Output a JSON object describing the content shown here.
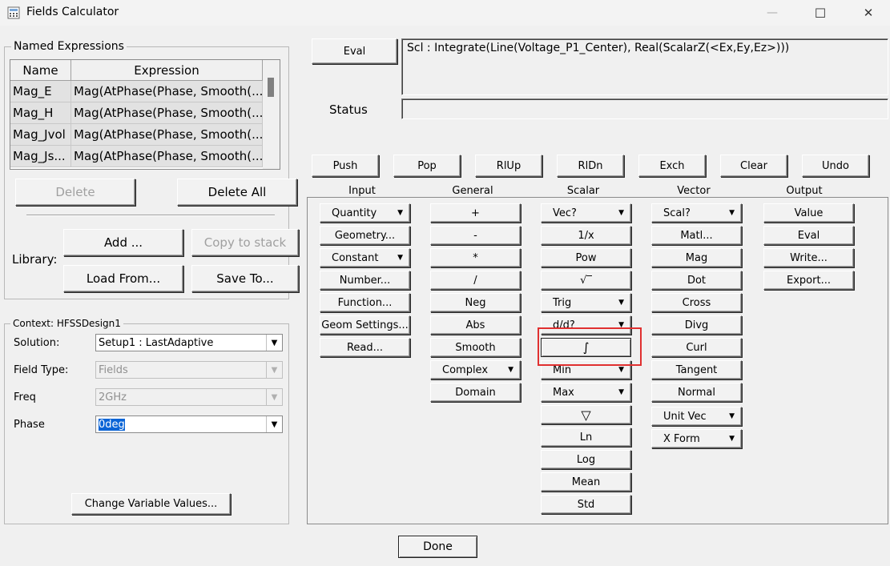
{
  "window": {
    "title": "Fields Calculator",
    "minimize": "—",
    "maximize": "☐",
    "close": "✕"
  },
  "named_expressions": {
    "group_label": "Named Expressions",
    "columns": [
      "Name",
      "Expression"
    ],
    "rows": [
      {
        "name": "Mag_E",
        "expression": "Mag(AtPhase(Phase, Smooth(..."
      },
      {
        "name": "Mag_H",
        "expression": "Mag(AtPhase(Phase, Smooth(..."
      },
      {
        "name": "Mag_Jvol",
        "expression": "Mag(AtPhase(Phase, Smooth(..."
      },
      {
        "name": "Mag_Js...",
        "expression": "Mag(AtPhase(Phase, Smooth(..."
      }
    ],
    "delete_label": "Delete",
    "delete_all_label": "Delete All",
    "library_label": "Library:",
    "add_label": "Add ...",
    "copy_to_stack_label": "Copy to stack",
    "load_from_label": "Load From...",
    "save_to_label": "Save To..."
  },
  "context": {
    "group_label": "Context: HFSSDesign1",
    "solution_label": "Solution:",
    "solution_value": "Setup1 : LastAdaptive",
    "field_type_label": "Field Type:",
    "field_type_value": "Fields",
    "freq_label": "Freq",
    "freq_value": "2GHz",
    "phase_label": "Phase",
    "phase_value": "0deg",
    "change_vars_label": "Change Variable Values..."
  },
  "top": {
    "eval_label": "Eval",
    "expression": "Scl : Integrate(Line(Voltage_P1_Center), Real(ScalarZ(<Ex,Ey,Ez>)))",
    "status_label": "Status",
    "status_value": ""
  },
  "stack_buttons": [
    "Push",
    "Pop",
    "RlUp",
    "RlDn",
    "Exch",
    "Clear",
    "Undo"
  ],
  "columns": {
    "input": {
      "title": "Input",
      "items": [
        "Quantity",
        "Geometry...",
        "Constant",
        "Number...",
        "Function...",
        "Geom Settings...",
        "Read..."
      ]
    },
    "general": {
      "title": "General",
      "items": [
        "+",
        "-",
        "*",
        "/",
        "Neg",
        "Abs",
        "Smooth",
        "Complex",
        "Domain"
      ]
    },
    "scalar": {
      "title": "Scalar",
      "items": [
        "Vec?",
        "1/x",
        "Pow",
        "√‾",
        "Trig",
        "d/d?",
        "∫",
        "Min",
        "Max",
        "▽",
        "Ln",
        "Log",
        "Mean",
        "Std"
      ]
    },
    "vector": {
      "title": "Vector",
      "items": [
        "Scal?",
        "Matl...",
        "Mag",
        "Dot",
        "Cross",
        "Divg",
        "Curl",
        "Tangent",
        "Normal",
        "Unit Vec",
        "X Form"
      ]
    },
    "output": {
      "title": "Output",
      "items": [
        "Value",
        "Eval",
        "Write...",
        "Export..."
      ]
    }
  },
  "done_label": "Done",
  "icons": {
    "dropdown": "▼",
    "dropdown_small": "⯆",
    "app": "calculator-icon"
  }
}
